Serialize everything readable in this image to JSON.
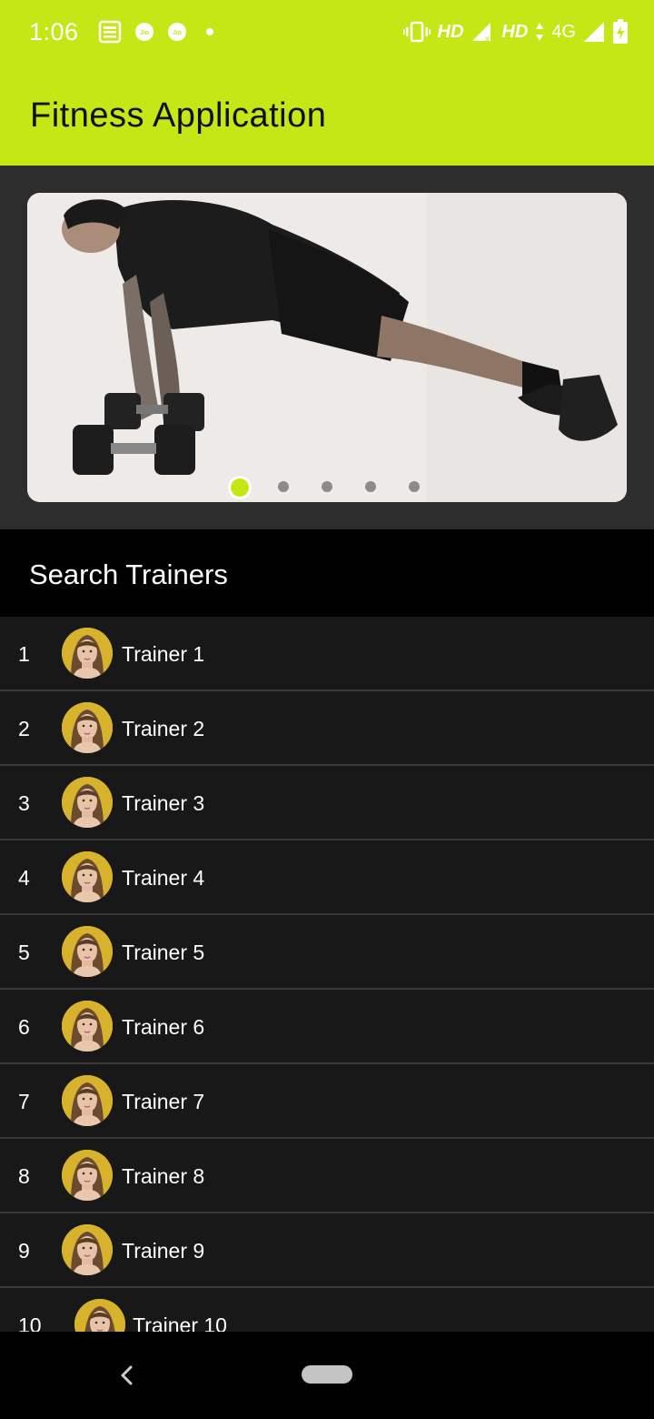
{
  "status_bar": {
    "time": "1:06",
    "network_label_1": "HD",
    "network_label_2": "HD",
    "network_label_3": "4G"
  },
  "app_bar": {
    "title": "Fitness Application",
    "color": "#c5e716"
  },
  "carousel": {
    "slide_count": 5,
    "active_index": 0
  },
  "trainers_section": {
    "title": "Search Trainers"
  },
  "trainers": [
    {
      "number": "1",
      "name": "Trainer 1"
    },
    {
      "number": "2",
      "name": "Trainer 2"
    },
    {
      "number": "3",
      "name": "Trainer 3"
    },
    {
      "number": "4",
      "name": "Trainer 4"
    },
    {
      "number": "5",
      "name": "Trainer 5"
    },
    {
      "number": "6",
      "name": "Trainer 6"
    },
    {
      "number": "7",
      "name": "Trainer 7"
    },
    {
      "number": "8",
      "name": "Trainer 8"
    },
    {
      "number": "9",
      "name": "Trainer 9"
    },
    {
      "number": "10",
      "name": "Trainer 10"
    }
  ],
  "nav_bar": {
    "back_icon": "chevron-left-icon",
    "home_icon": "home-pill-icon"
  }
}
